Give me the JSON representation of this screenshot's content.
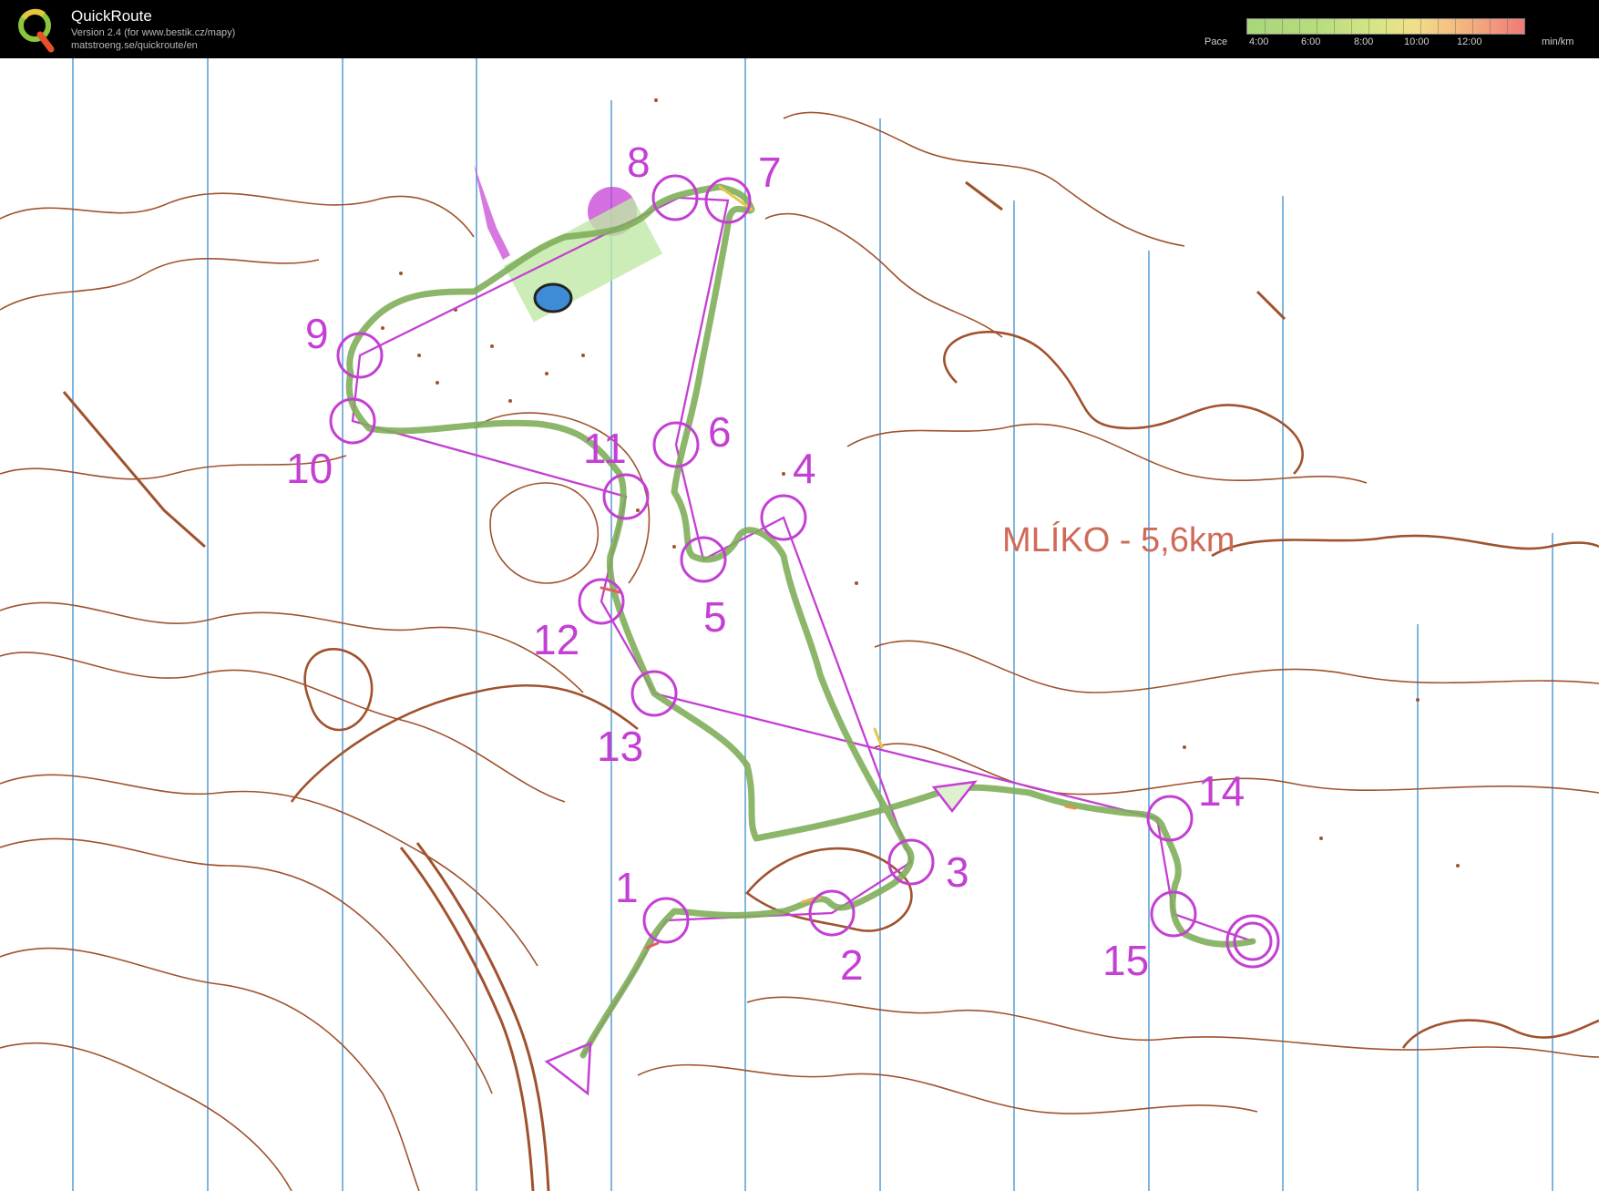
{
  "header": {
    "app_title": "QuickRoute",
    "version": "Version 2.4  (for www.bestik.cz/mapy)",
    "url": "matstroeng.se/quickroute/en",
    "logo_letter": "Q"
  },
  "pace_legend": {
    "label": "Pace",
    "ticks": [
      "4:00",
      "6:00",
      "8:00",
      "10:00",
      "12:00"
    ],
    "unit": "min/km"
  },
  "map": {
    "course_title": "MLÍKO - 5,6km",
    "control_numbers": [
      "1",
      "2",
      "3",
      "4",
      "5",
      "6",
      "7",
      "8",
      "9",
      "10",
      "11",
      "12",
      "13",
      "14",
      "15"
    ]
  },
  "colors": {
    "course": "#c43fd3",
    "contour": "#a0522d",
    "route": "#7fae5a",
    "north_lines": "#3b8fd0",
    "title": "#d06a58"
  }
}
